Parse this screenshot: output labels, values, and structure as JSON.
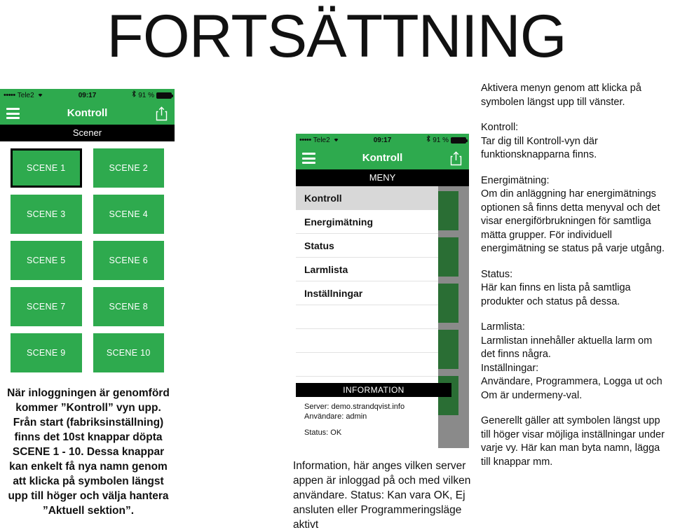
{
  "page": {
    "title": "FORTSÄTTNING",
    "background_color": "#ffffff",
    "brand_green": "#2eaa4e",
    "dim_green": "#2a6e34",
    "gray_backdrop": "#8a8a8a",
    "black": "#000000"
  },
  "status_bar": {
    "signal_dots": "•••••",
    "carrier": "Tele2",
    "wifi_icon": "wifi-icon",
    "time": "09:17",
    "bluetooth_icon": "bluetooth-icon",
    "battery_percent": "91 %",
    "battery_icon": "battery-icon"
  },
  "phone_left": {
    "nav": {
      "menu_icon": "hamburger-icon",
      "title": "Kontroll",
      "share_icon": "share-icon"
    },
    "section_label": "Scener",
    "scenes": [
      {
        "label": "SCENE 1",
        "selected": true
      },
      {
        "label": "SCENE 2",
        "selected": false
      },
      {
        "label": "SCENE 3",
        "selected": false
      },
      {
        "label": "SCENE 4",
        "selected": false
      },
      {
        "label": "SCENE 5",
        "selected": false
      },
      {
        "label": "SCENE 6",
        "selected": false
      },
      {
        "label": "SCENE 7",
        "selected": false
      },
      {
        "label": "SCENE 8",
        "selected": false
      },
      {
        "label": "SCENE 9",
        "selected": false
      },
      {
        "label": "SCENE 10",
        "selected": false
      }
    ],
    "caption": "När inloggningen är genomförd kommer ”Kontroll” vyn upp. Från start (fabriksinställning) finns det 10st knappar döpta SCENE 1 - 10. Dessa knappar kan enkelt få nya namn genom att klicka på symbolen längst upp till höger och välja hantera ”Aktuell sektion”."
  },
  "phone_center": {
    "nav": {
      "menu_icon": "hamburger-icon",
      "title": "Kontroll",
      "share_icon": "share-icon"
    },
    "section_label": "MENY",
    "menu_items": [
      {
        "label": "Kontroll",
        "active": true
      },
      {
        "label": "Energimätning",
        "active": false
      },
      {
        "label": "Status",
        "active": false
      },
      {
        "label": "Larmlista",
        "active": false
      },
      {
        "label": "Inställningar",
        "active": false
      },
      {
        "label": "",
        "active": false
      },
      {
        "label": "",
        "active": false
      },
      {
        "label": "",
        "active": false
      },
      {
        "label": "",
        "active": false
      }
    ],
    "information": {
      "header": "INFORMATION",
      "server_line": "Server: demo.strandqvist.info",
      "user_line": "Användare: admin",
      "status_line": "Status: OK"
    },
    "caption": "Information, här anges vilken server appen är inloggad på och med vilken användare. Status: Kan vara OK, Ej ansluten eller Programmeringsläge aktivt"
  },
  "notes": {
    "intro": "Aktivera menyn genom att klicka på symbolen längst upp till vänster.",
    "sections": [
      {
        "heading": "Kontroll:",
        "body": "Tar dig till Kontroll-vyn där funktionsknapparna finns."
      },
      {
        "heading": "Energimätning:",
        "body": "Om din anläggning har energimätnings optionen så finns detta menyval och det visar energiförbrukningen för samtliga mätta grupper. För individuell energimätning se status på varje utgång."
      },
      {
        "heading": "Status:",
        "body": "Här kan finns en lista på samtliga produkter och status på dessa."
      },
      {
        "heading": "Larmlista:",
        "body": "Larmlistan innehåller aktuella larm om det finns några."
      },
      {
        "heading": "Inställningar:",
        "body": "Användare, Programmera, Logga ut och Om är undermeny-val."
      }
    ],
    "footer": "Generellt gäller att symbolen längst upp till höger visar möjliga inställningar under varje vy. Här kan man byta namn, lägga till knappar mm."
  }
}
